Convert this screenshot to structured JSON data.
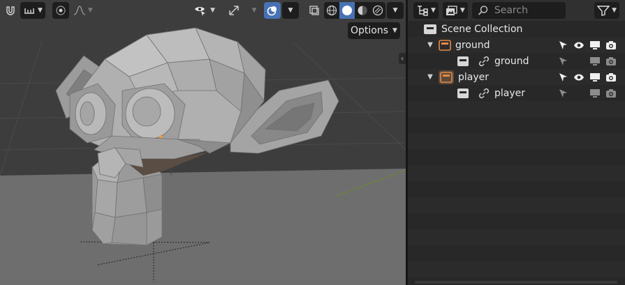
{
  "viewport": {
    "options_label": "Options",
    "colors": {
      "background": "#3d3d3d",
      "floor": "#6f6f6f",
      "mesh": "#a9a9a9",
      "accent": "#4772b3"
    }
  },
  "outliner": {
    "search": {
      "placeholder": "Search"
    },
    "root": {
      "label": "Scene Collection"
    },
    "collections": [
      {
        "label": "ground",
        "icon": "collection-icon",
        "object": {
          "label": "ground",
          "icon": "linked-mesh-icon"
        }
      },
      {
        "label": "player",
        "icon": "collection-icon",
        "object": {
          "label": "player",
          "icon": "linked-mesh-icon"
        }
      }
    ],
    "colors": {
      "collection": "#e58a45",
      "background": "#282828"
    }
  }
}
